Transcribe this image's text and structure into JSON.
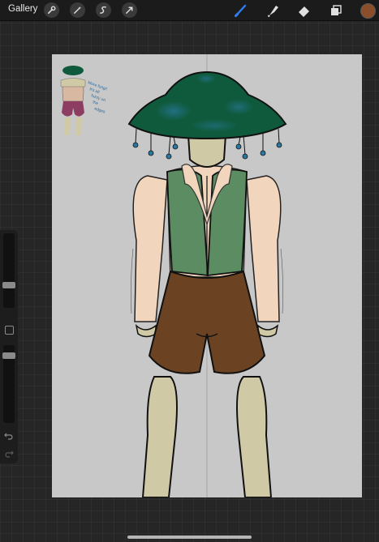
{
  "topbar": {
    "gallery_label": "Gallery",
    "left_tools": [
      {
        "name": "wrench-icon",
        "label": "Actions"
      },
      {
        "name": "magic-wand-icon",
        "label": "Adjustments"
      },
      {
        "name": "selection-icon",
        "label": "Selection"
      },
      {
        "name": "transform-arrow-icon",
        "label": "Transform"
      }
    ],
    "right_tools": [
      {
        "name": "brush-icon",
        "state": "active"
      },
      {
        "name": "smudge-icon",
        "state": "inactive"
      },
      {
        "name": "eraser-icon",
        "state": "inactive"
      },
      {
        "name": "layers-icon",
        "state": "inactive"
      }
    ],
    "current_color": "#8a4f2a"
  },
  "sidebar": {
    "brush_size_level": 0.28,
    "opacity_level": 0.9,
    "controls": [
      "undo-icon",
      "redo-icon",
      "modify-square-icon"
    ]
  },
  "canvas": {
    "reference_note": "More fungi! It's all fuzzy on the edges",
    "palette": {
      "cap": "#0f5a3c",
      "vest": "#5c8c62",
      "shirt": "#f1d5bd",
      "shorts": "#6b4323",
      "skin": "#cfc9a6",
      "outline": "#111111",
      "drops": "#2a78a0",
      "sketch_shorts": "#8d3d62"
    }
  }
}
